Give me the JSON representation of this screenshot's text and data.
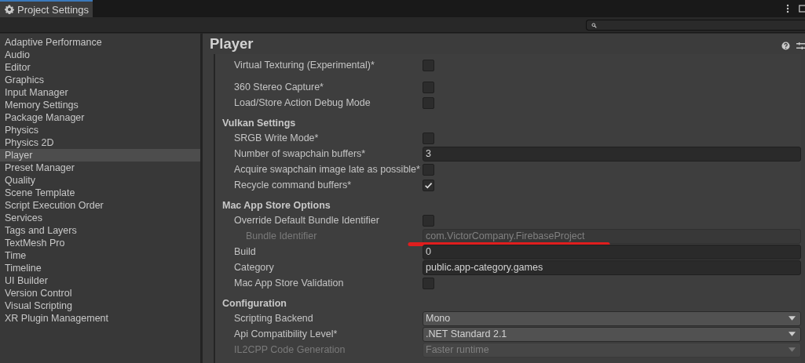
{
  "window": {
    "title": "Project Settings"
  },
  "sidebar": {
    "items": [
      {
        "label": "Adaptive Performance",
        "selected": false
      },
      {
        "label": "Audio",
        "selected": false
      },
      {
        "label": "Editor",
        "selected": false
      },
      {
        "label": "Graphics",
        "selected": false
      },
      {
        "label": "Input Manager",
        "selected": false
      },
      {
        "label": "Memory Settings",
        "selected": false
      },
      {
        "label": "Package Manager",
        "selected": false
      },
      {
        "label": "Physics",
        "selected": false
      },
      {
        "label": "Physics 2D",
        "selected": false
      },
      {
        "label": "Player",
        "selected": true
      },
      {
        "label": "Preset Manager",
        "selected": false
      },
      {
        "label": "Quality",
        "selected": false
      },
      {
        "label": "Scene Template",
        "selected": false
      },
      {
        "label": "Script Execution Order",
        "selected": false
      },
      {
        "label": "Services",
        "selected": false
      },
      {
        "label": "Tags and Layers",
        "selected": false
      },
      {
        "label": "TextMesh Pro",
        "selected": false
      },
      {
        "label": "Time",
        "selected": false
      },
      {
        "label": "Timeline",
        "selected": false
      },
      {
        "label": "UI Builder",
        "selected": false
      },
      {
        "label": "Version Control",
        "selected": false
      },
      {
        "label": "Visual Scripting",
        "selected": false
      },
      {
        "label": "XR Plugin Management",
        "selected": false
      }
    ]
  },
  "page": {
    "title": "Player",
    "sections": [
      {
        "rows": [
          {
            "kind": "checkbox",
            "label": "Virtual Texturing (Experimental)*",
            "checked": false,
            "disabled": false
          },
          {
            "kind": "spacer"
          },
          {
            "kind": "checkbox",
            "label": "360 Stereo Capture*",
            "checked": false,
            "disabled": false
          },
          {
            "kind": "checkbox",
            "label": "Load/Store Action Debug Mode",
            "checked": false,
            "disabled": false
          }
        ]
      },
      {
        "title": "Vulkan Settings",
        "rows": [
          {
            "kind": "checkbox",
            "label": "SRGB Write Mode*",
            "checked": false,
            "disabled": false
          },
          {
            "kind": "text",
            "label": "Number of swapchain buffers*",
            "value": "3",
            "disabled": false
          },
          {
            "kind": "checkbox",
            "label": "Acquire swapchain image late as possible*",
            "checked": false,
            "disabled": false
          },
          {
            "kind": "checkbox",
            "label": "Recycle command buffers*",
            "checked": true,
            "disabled": false
          }
        ]
      },
      {
        "title": "Mac App Store Options",
        "rows": [
          {
            "kind": "checkbox",
            "label": "Override Default Bundle Identifier",
            "checked": false,
            "disabled": false,
            "children": [
              {
                "kind": "text",
                "label": "Bundle Identifier",
                "value": "com.VictorCompany.FirebaseProject",
                "disabled": true
              }
            ]
          },
          {
            "kind": "text",
            "label": "Build",
            "value": "0",
            "disabled": false
          },
          {
            "kind": "text",
            "label": "Category",
            "value": "public.app-category.games",
            "disabled": false
          },
          {
            "kind": "checkbox",
            "label": "Mac App Store Validation",
            "checked": false,
            "disabled": false
          }
        ]
      },
      {
        "title": "Configuration",
        "rows": [
          {
            "kind": "dropdown",
            "label": "Scripting Backend",
            "value": "Mono",
            "disabled": false
          },
          {
            "kind": "dropdown",
            "label": "Api Compatibility Level*",
            "value": ".NET Standard 2.1",
            "disabled": false
          },
          {
            "kind": "dropdown",
            "label": "IL2CPP Code Generation",
            "value": "Faster runtime",
            "disabled": true
          }
        ]
      }
    ]
  }
}
